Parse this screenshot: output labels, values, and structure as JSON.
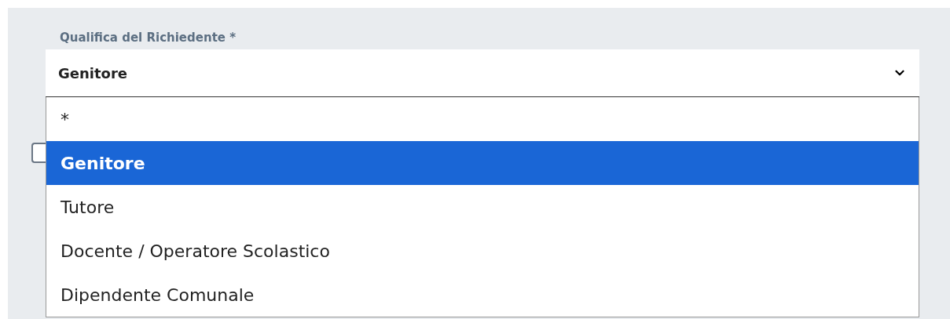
{
  "field": {
    "label": "Qualifica del Richiedente *",
    "value": "Genitore"
  },
  "checkbox": {
    "checked": false
  },
  "options": [
    {
      "label": "*",
      "selected": false
    },
    {
      "label": "Genitore",
      "selected": true
    },
    {
      "label": "Tutore",
      "selected": false
    },
    {
      "label": "Docente / Operatore Scolastico",
      "selected": false
    },
    {
      "label": "Dipendente Comunale",
      "selected": false
    }
  ]
}
